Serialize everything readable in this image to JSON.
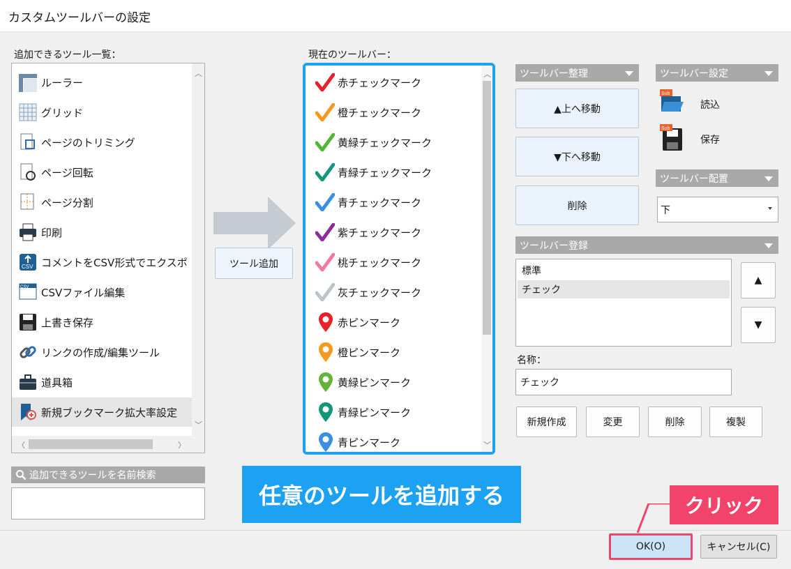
{
  "window": {
    "title": "カスタムツールバーの設定"
  },
  "available": {
    "label": "追加できるツール一覧：",
    "items": [
      {
        "label": "ルーラー",
        "icon": "ruler-icon"
      },
      {
        "label": "グリッド",
        "icon": "grid-icon"
      },
      {
        "label": "ページのトリミング",
        "icon": "page-trim-icon"
      },
      {
        "label": "ページ回転",
        "icon": "page-rotate-icon"
      },
      {
        "label": "ページ分割",
        "icon": "page-split-icon"
      },
      {
        "label": "印刷",
        "icon": "printer-icon"
      },
      {
        "label": "コメントをCSV形式でエクスポ",
        "icon": "csv-export-icon"
      },
      {
        "label": "CSVファイル編集",
        "icon": "csv-edit-icon"
      },
      {
        "label": "上書き保存",
        "icon": "save-icon"
      },
      {
        "label": "リンクの作成/編集ツール",
        "icon": "link-icon"
      },
      {
        "label": "道具箱",
        "icon": "toolbox-icon"
      },
      {
        "label": "新規ブックマーク拡大率設定",
        "icon": "bookmark-zoom-icon"
      }
    ],
    "search_label": "追加できるツールを名前検索",
    "search_value": ""
  },
  "add_button": "ツール追加",
  "current": {
    "label": "現在のツールバー：",
    "items": [
      {
        "label": "赤チェックマーク",
        "color": "#e8202a",
        "kind": "check"
      },
      {
        "label": "橙チェックマーク",
        "color": "#f39a1e",
        "kind": "check"
      },
      {
        "label": "黄緑チェックマーク",
        "color": "#4fb637",
        "kind": "check"
      },
      {
        "label": "青緑チェックマーク",
        "color": "#14967b",
        "kind": "check"
      },
      {
        "label": "青チェックマーク",
        "color": "#3b8fe0",
        "kind": "check"
      },
      {
        "label": "紫チェックマーク",
        "color": "#8a2d97",
        "kind": "check"
      },
      {
        "label": "桃チェックマーク",
        "color": "#f07aa2",
        "kind": "check"
      },
      {
        "label": "灰チェックマーク",
        "color": "#bcc3c9",
        "kind": "check"
      },
      {
        "label": "赤ピンマーク",
        "color": "#e8202a",
        "kind": "pin"
      },
      {
        "label": "橙ピンマーク",
        "color": "#f39a1e",
        "kind": "pin"
      },
      {
        "label": "黄緑ピンマーク",
        "color": "#62b33a",
        "kind": "pin"
      },
      {
        "label": "青緑ピンマーク",
        "color": "#14967b",
        "kind": "pin"
      },
      {
        "label": "青ピンマーク",
        "color": "#3b8fe0",
        "kind": "pin"
      }
    ]
  },
  "organize": {
    "header": "ツールバー整理",
    "move_up": "▲上へ移動",
    "move_down": "▼下へ移動",
    "delete": "削除"
  },
  "settings": {
    "header": "ツールバー設定",
    "load": "読込",
    "save": "保存",
    "sub_badge": "Sub"
  },
  "placement": {
    "header": "ツールバー配置",
    "value": "下"
  },
  "register": {
    "header": "ツールバー登録",
    "items": [
      "標準",
      "チェック"
    ],
    "up": "▲",
    "down": "▼",
    "name_label": "名称：",
    "name_value": "チェック",
    "new": "新規作成",
    "change": "変更",
    "delete": "削除",
    "duplicate": "複製"
  },
  "footer": {
    "ok": "OK(O)",
    "cancel": "キャンセル(C)"
  },
  "annotations": {
    "banner": "任意のツールを追加する",
    "callout": "クリック",
    "accent": "#1da1f2",
    "callout_color": "#f2436a"
  }
}
